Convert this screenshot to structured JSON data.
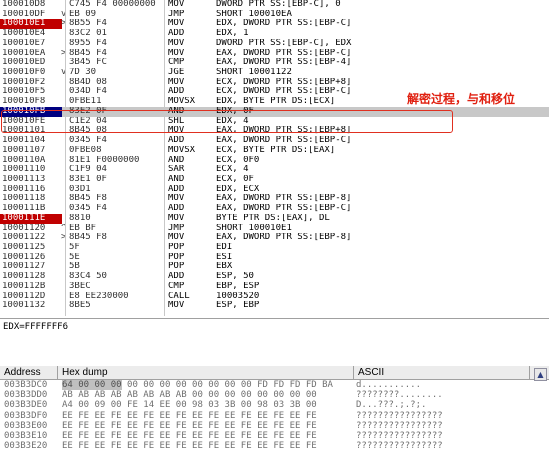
{
  "disassembly": [
    {
      "addr": "100010D8",
      "mark": "",
      "hex": "C745 F4 00000000",
      "mnem": "MOV",
      "ops": "DWORD PTR SS:[EBP-C], 0",
      "flag": ""
    },
    {
      "addr": "100010DF",
      "mark": "v",
      "hex": "EB 09",
      "mnem": "JMP",
      "ops": "SHORT 100010EA",
      "flag": ""
    },
    {
      "addr": "100010E1",
      "mark": ">",
      "hex": "8B55 F4",
      "mnem": "MOV",
      "ops": "EDX, DWORD PTR SS:[EBP-C]",
      "flag": "bp"
    },
    {
      "addr": "100010E4",
      "mark": "",
      "hex": "83C2 01",
      "mnem": "ADD",
      "ops": "EDX, 1",
      "flag": ""
    },
    {
      "addr": "100010E7",
      "mark": "",
      "hex": "8955 F4",
      "mnem": "MOV",
      "ops": "DWORD PTR SS:[EBP-C], EDX",
      "flag": ""
    },
    {
      "addr": "100010EA",
      "mark": ">",
      "hex": "8B45 F4",
      "mnem": "MOV",
      "ops": "EAX, DWORD PTR SS:[EBP-C]",
      "flag": ""
    },
    {
      "addr": "100010ED",
      "mark": "",
      "hex": "3B45 FC",
      "mnem": "CMP",
      "ops": "EAX, DWORD PTR SS:[EBP-4]",
      "flag": ""
    },
    {
      "addr": "100010F0",
      "mark": "v",
      "hex": "7D 30",
      "mnem": "JGE",
      "ops": "SHORT 10001122",
      "flag": ""
    },
    {
      "addr": "100010F2",
      "mark": "",
      "hex": "8B4D 08",
      "mnem": "MOV",
      "ops": "ECX, DWORD PTR SS:[EBP+8]",
      "flag": ""
    },
    {
      "addr": "100010F5",
      "mark": "",
      "hex": "034D F4",
      "mnem": "ADD",
      "ops": "ECX, DWORD PTR SS:[EBP-C]",
      "flag": ""
    },
    {
      "addr": "100010F8",
      "mark": "",
      "hex": "0FBE11",
      "mnem": "MOVSX",
      "ops": "EDX, BYTE PTR DS:[ECX]",
      "flag": ""
    },
    {
      "addr": "100010FB",
      "mark": "",
      "hex": "83E2 0F",
      "mnem": "AND",
      "ops": "EDX, 0F",
      "flag": "selected"
    },
    {
      "addr": "100010FE",
      "mark": "",
      "hex": "C1E2 04",
      "mnem": "SHL",
      "ops": "EDX, 4",
      "flag": ""
    },
    {
      "addr": "10001101",
      "mark": "",
      "hex": "8B45 08",
      "mnem": "MOV",
      "ops": "EAX, DWORD PTR SS:[EBP+8]",
      "flag": ""
    },
    {
      "addr": "10001104",
      "mark": "",
      "hex": "0345 F4",
      "mnem": "ADD",
      "ops": "EAX, DWORD PTR SS:[EBP-C]",
      "flag": ""
    },
    {
      "addr": "10001107",
      "mark": "",
      "hex": "0FBE08",
      "mnem": "MOVSX",
      "ops": "ECX, BYTE PTR DS:[EAX]",
      "flag": ""
    },
    {
      "addr": "1000110A",
      "mark": "",
      "hex": "81E1 F0000000",
      "mnem": "AND",
      "ops": "ECX, 0F0",
      "flag": ""
    },
    {
      "addr": "10001110",
      "mark": "",
      "hex": "C1F9 04",
      "mnem": "SAR",
      "ops": "ECX, 4",
      "flag": ""
    },
    {
      "addr": "10001113",
      "mark": "",
      "hex": "83E1 0F",
      "mnem": "AND",
      "ops": "ECX, 0F",
      "flag": ""
    },
    {
      "addr": "10001116",
      "mark": "",
      "hex": "03D1",
      "mnem": "ADD",
      "ops": "EDX, ECX",
      "flag": ""
    },
    {
      "addr": "10001118",
      "mark": "",
      "hex": "8B45 F8",
      "mnem": "MOV",
      "ops": "EAX, DWORD PTR SS:[EBP-8]",
      "flag": ""
    },
    {
      "addr": "1000111B",
      "mark": "",
      "hex": "0345 F4",
      "mnem": "ADD",
      "ops": "EAX, DWORD PTR SS:[EBP-C]",
      "flag": ""
    },
    {
      "addr": "1000111E",
      "mark": "",
      "hex": "8810",
      "mnem": "MOV",
      "ops": "BYTE PTR DS:[EAX], DL",
      "flag": "bp"
    },
    {
      "addr": "10001120",
      "mark": "^",
      "hex": "EB BF",
      "mnem": "JMP",
      "ops": "SHORT 100010E1",
      "flag": ""
    },
    {
      "addr": "10001122",
      "mark": ">",
      "hex": "8B45 F8",
      "mnem": "MOV",
      "ops": "EAX, DWORD PTR SS:[EBP-8]",
      "flag": ""
    },
    {
      "addr": "10001125",
      "mark": "",
      "hex": "5F",
      "mnem": "POP",
      "ops": "EDI",
      "flag": ""
    },
    {
      "addr": "10001126",
      "mark": "",
      "hex": "5E",
      "mnem": "POP",
      "ops": "ESI",
      "flag": ""
    },
    {
      "addr": "10001127",
      "mark": "",
      "hex": "5B",
      "mnem": "POP",
      "ops": "EBX",
      "flag": ""
    },
    {
      "addr": "10001128",
      "mark": "",
      "hex": "83C4 50",
      "mnem": "ADD",
      "ops": "ESP, 50",
      "flag": ""
    },
    {
      "addr": "1000112B",
      "mark": "",
      "hex": "3BEC",
      "mnem": "CMP",
      "ops": "EBP, ESP",
      "flag": ""
    },
    {
      "addr": "1000112D",
      "mark": "",
      "hex": "E8 EE230000",
      "mnem": "CALL",
      "ops": "10003520",
      "flag": ""
    },
    {
      "addr": "10001132",
      "mark": "",
      "hex": "8BE5",
      "mnem": "MOV",
      "ops": "ESP, EBP",
      "flag": ""
    }
  ],
  "annotation": "解密过程，与和移位",
  "info": "EDX=FFFFFFF6",
  "dump": {
    "headers": {
      "address": "Address",
      "hex": "Hex dump",
      "ascii": "ASCII"
    },
    "scroll_up_glyph": "▲",
    "rows": [
      {
        "addr": "003B3DC0",
        "hex_hl": "64 00 00 00",
        "hex": " 00 00 00 00 00 00 00 00 FD FD FD FD BA",
        "ascii": "d..........."
      },
      {
        "addr": "003B3DD0",
        "hex_hl": "",
        "hex": "AB AB AB AB AB AB AB AB 00 00 00 00 00 00 00 00",
        "ascii": "????????........"
      },
      {
        "addr": "003B3DE0",
        "hex_hl": "",
        "hex": "A4 00 09 00 FE 14 EE 00 98 03 3B 00 98 03 3B 00",
        "ascii": "D...???.;.?;."
      },
      {
        "addr": "003B3DF0",
        "hex_hl": "",
        "hex": "EE FE EE FE EE FE EE FE EE FE EE FE EE FE EE FE",
        "ascii": "????????????????"
      },
      {
        "addr": "003B3E00",
        "hex_hl": "",
        "hex": "EE FE EE FE EE FE EE FE EE FE EE FE EE FE EE FE",
        "ascii": "????????????????"
      },
      {
        "addr": "003B3E10",
        "hex_hl": "",
        "hex": "EE FE EE FE EE FE EE FE EE FE EE FE EE FE EE FE",
        "ascii": "????????????????"
      },
      {
        "addr": "003B3E20",
        "hex_hl": "",
        "hex": "EE FE EE FE EE FE EE FE EE FE EE FE EE FE EE FE",
        "ascii": "????????????????"
      }
    ]
  }
}
